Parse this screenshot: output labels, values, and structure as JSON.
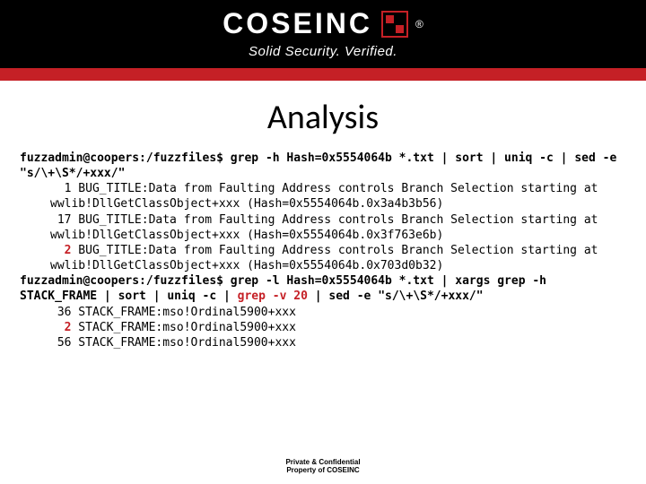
{
  "brand": {
    "name": "COSEINC",
    "registered": "®",
    "tagline": "Solid Security. Verified."
  },
  "title": "Analysis",
  "code": {
    "prompt1": "fuzzadmin@coopers:/fuzzfiles$",
    "cmd1": " grep -h Hash=0x5554064b *.txt | sort | uniq -c | sed -e \"s/\\+\\S*/+xxx/\"",
    "l1": "  1 BUG_TITLE:Data from Faulting Address controls Branch Selection starting at wwlib!DllGetClassObject+xxx (Hash=0x5554064b.0x3a4b3b56)",
    "l2": " 17 BUG_TITLE:Data from Faulting Address controls Branch Selection starting at wwlib!DllGetClassObject+xxx (Hash=0x5554064b.0x3f763e6b)",
    "l3_pre": "  ",
    "l3_hl": "2",
    "l3_post": " BUG_TITLE:Data from Faulting Address controls Branch Selection starting at wwlib!DllGetClassObject+xxx (Hash=0x5554064b.0x703d0b32)",
    "prompt2": "fuzzadmin@coopers:/fuzzfiles$",
    "cmd2a": " grep -l Hash=0x5554064b *.txt | xargs grep -h STACK_FRAME | sort | uniq -c | ",
    "cmd2_hl": "grep -v 20",
    "cmd2b": " | sed -e \"s/\\+\\S*/+xxx/\"",
    "l4": " 36 STACK_FRAME:mso!Ordinal5900+xxx",
    "l5_pre": "  ",
    "l5_hl": "2",
    "l5_post": " STACK_FRAME:mso!Ordinal5900+xxx",
    "l6": " 56 STACK_FRAME:mso!Ordinal5900+xxx"
  },
  "footer": {
    "line1": "Private & Confidential",
    "line2": "Property of COSEINC"
  }
}
